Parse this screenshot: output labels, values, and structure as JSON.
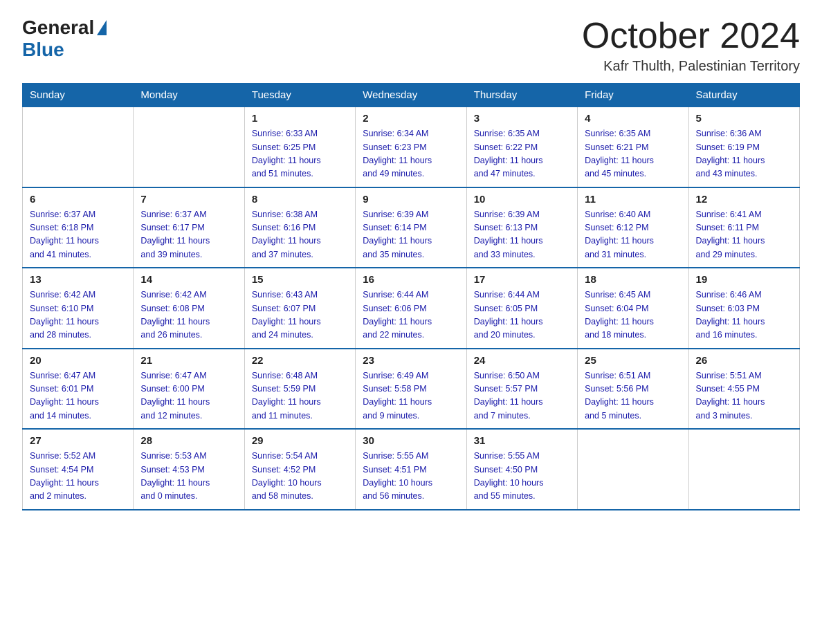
{
  "logo": {
    "general": "General",
    "blue": "Blue"
  },
  "title": "October 2024",
  "subtitle": "Kafr Thulth, Palestinian Territory",
  "headers": [
    "Sunday",
    "Monday",
    "Tuesday",
    "Wednesday",
    "Thursday",
    "Friday",
    "Saturday"
  ],
  "weeks": [
    [
      {
        "day": "",
        "info": ""
      },
      {
        "day": "",
        "info": ""
      },
      {
        "day": "1",
        "info": "Sunrise: 6:33 AM\nSunset: 6:25 PM\nDaylight: 11 hours\nand 51 minutes."
      },
      {
        "day": "2",
        "info": "Sunrise: 6:34 AM\nSunset: 6:23 PM\nDaylight: 11 hours\nand 49 minutes."
      },
      {
        "day": "3",
        "info": "Sunrise: 6:35 AM\nSunset: 6:22 PM\nDaylight: 11 hours\nand 47 minutes."
      },
      {
        "day": "4",
        "info": "Sunrise: 6:35 AM\nSunset: 6:21 PM\nDaylight: 11 hours\nand 45 minutes."
      },
      {
        "day": "5",
        "info": "Sunrise: 6:36 AM\nSunset: 6:19 PM\nDaylight: 11 hours\nand 43 minutes."
      }
    ],
    [
      {
        "day": "6",
        "info": "Sunrise: 6:37 AM\nSunset: 6:18 PM\nDaylight: 11 hours\nand 41 minutes."
      },
      {
        "day": "7",
        "info": "Sunrise: 6:37 AM\nSunset: 6:17 PM\nDaylight: 11 hours\nand 39 minutes."
      },
      {
        "day": "8",
        "info": "Sunrise: 6:38 AM\nSunset: 6:16 PM\nDaylight: 11 hours\nand 37 minutes."
      },
      {
        "day": "9",
        "info": "Sunrise: 6:39 AM\nSunset: 6:14 PM\nDaylight: 11 hours\nand 35 minutes."
      },
      {
        "day": "10",
        "info": "Sunrise: 6:39 AM\nSunset: 6:13 PM\nDaylight: 11 hours\nand 33 minutes."
      },
      {
        "day": "11",
        "info": "Sunrise: 6:40 AM\nSunset: 6:12 PM\nDaylight: 11 hours\nand 31 minutes."
      },
      {
        "day": "12",
        "info": "Sunrise: 6:41 AM\nSunset: 6:11 PM\nDaylight: 11 hours\nand 29 minutes."
      }
    ],
    [
      {
        "day": "13",
        "info": "Sunrise: 6:42 AM\nSunset: 6:10 PM\nDaylight: 11 hours\nand 28 minutes."
      },
      {
        "day": "14",
        "info": "Sunrise: 6:42 AM\nSunset: 6:08 PM\nDaylight: 11 hours\nand 26 minutes."
      },
      {
        "day": "15",
        "info": "Sunrise: 6:43 AM\nSunset: 6:07 PM\nDaylight: 11 hours\nand 24 minutes."
      },
      {
        "day": "16",
        "info": "Sunrise: 6:44 AM\nSunset: 6:06 PM\nDaylight: 11 hours\nand 22 minutes."
      },
      {
        "day": "17",
        "info": "Sunrise: 6:44 AM\nSunset: 6:05 PM\nDaylight: 11 hours\nand 20 minutes."
      },
      {
        "day": "18",
        "info": "Sunrise: 6:45 AM\nSunset: 6:04 PM\nDaylight: 11 hours\nand 18 minutes."
      },
      {
        "day": "19",
        "info": "Sunrise: 6:46 AM\nSunset: 6:03 PM\nDaylight: 11 hours\nand 16 minutes."
      }
    ],
    [
      {
        "day": "20",
        "info": "Sunrise: 6:47 AM\nSunset: 6:01 PM\nDaylight: 11 hours\nand 14 minutes."
      },
      {
        "day": "21",
        "info": "Sunrise: 6:47 AM\nSunset: 6:00 PM\nDaylight: 11 hours\nand 12 minutes."
      },
      {
        "day": "22",
        "info": "Sunrise: 6:48 AM\nSunset: 5:59 PM\nDaylight: 11 hours\nand 11 minutes."
      },
      {
        "day": "23",
        "info": "Sunrise: 6:49 AM\nSunset: 5:58 PM\nDaylight: 11 hours\nand 9 minutes."
      },
      {
        "day": "24",
        "info": "Sunrise: 6:50 AM\nSunset: 5:57 PM\nDaylight: 11 hours\nand 7 minutes."
      },
      {
        "day": "25",
        "info": "Sunrise: 6:51 AM\nSunset: 5:56 PM\nDaylight: 11 hours\nand 5 minutes."
      },
      {
        "day": "26",
        "info": "Sunrise: 5:51 AM\nSunset: 4:55 PM\nDaylight: 11 hours\nand 3 minutes."
      }
    ],
    [
      {
        "day": "27",
        "info": "Sunrise: 5:52 AM\nSunset: 4:54 PM\nDaylight: 11 hours\nand 2 minutes."
      },
      {
        "day": "28",
        "info": "Sunrise: 5:53 AM\nSunset: 4:53 PM\nDaylight: 11 hours\nand 0 minutes."
      },
      {
        "day": "29",
        "info": "Sunrise: 5:54 AM\nSunset: 4:52 PM\nDaylight: 10 hours\nand 58 minutes."
      },
      {
        "day": "30",
        "info": "Sunrise: 5:55 AM\nSunset: 4:51 PM\nDaylight: 10 hours\nand 56 minutes."
      },
      {
        "day": "31",
        "info": "Sunrise: 5:55 AM\nSunset: 4:50 PM\nDaylight: 10 hours\nand 55 minutes."
      },
      {
        "day": "",
        "info": ""
      },
      {
        "day": "",
        "info": ""
      }
    ]
  ]
}
